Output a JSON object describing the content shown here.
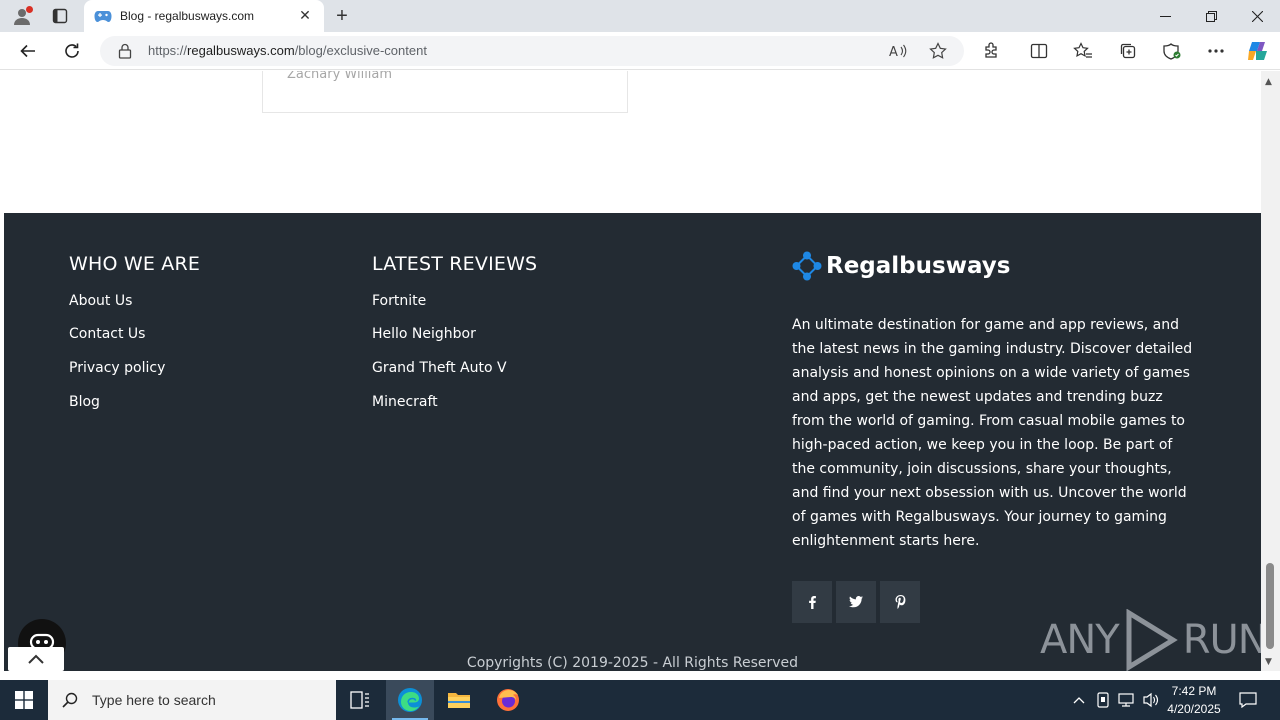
{
  "browser": {
    "tab_title": "Blog - regalbusways.com",
    "url_prefix": "https://",
    "url_host": "regalbusways.com",
    "url_path": "/blog/exclusive-content"
  },
  "page": {
    "author_name": "Zachary William",
    "footer": {
      "who_we_are": {
        "heading": "WHO WE ARE",
        "links": [
          "About Us",
          "Contact Us",
          "Privacy policy",
          "Blog"
        ]
      },
      "latest_reviews": {
        "heading": "LATEST REVIEWS",
        "links": [
          "Fortnite",
          "Hello Neighbor",
          "Grand Theft Auto V",
          "Minecraft"
        ]
      },
      "brand": {
        "name": "Regalbusways",
        "description": "An ultimate destination for game and app reviews, and the latest news in the gaming industry. Discover detailed analysis and honest opinions on a wide variety of games and apps, get the newest updates and trending buzz from the world of gaming. From casual mobile games to high-paced action, we keep you in the loop. Be part of the community, join discussions, share your thoughts, and find your next obsession with us. Uncover the world of games with Regalbusways. Your journey to gaming enlightenment starts here."
      },
      "socials": [
        {
          "icon": "facebook-icon",
          "glyph": "f"
        },
        {
          "icon": "twitter-icon",
          "glyph": "t"
        },
        {
          "icon": "pinterest-icon",
          "glyph": "p"
        }
      ],
      "copyright": "Copyrights (C) 2019-2025 - All Rights Reserved"
    },
    "watermark": {
      "left": "ANY",
      "right": "RUN"
    }
  },
  "taskbar": {
    "search_placeholder": "Type here to search",
    "time": "7:42 PM",
    "date": "4/20/2025"
  },
  "colors": {
    "footer_bg": "#232b33",
    "brand_accent": "#1e88e5",
    "taskbar_bg": "#1c2b3a"
  }
}
